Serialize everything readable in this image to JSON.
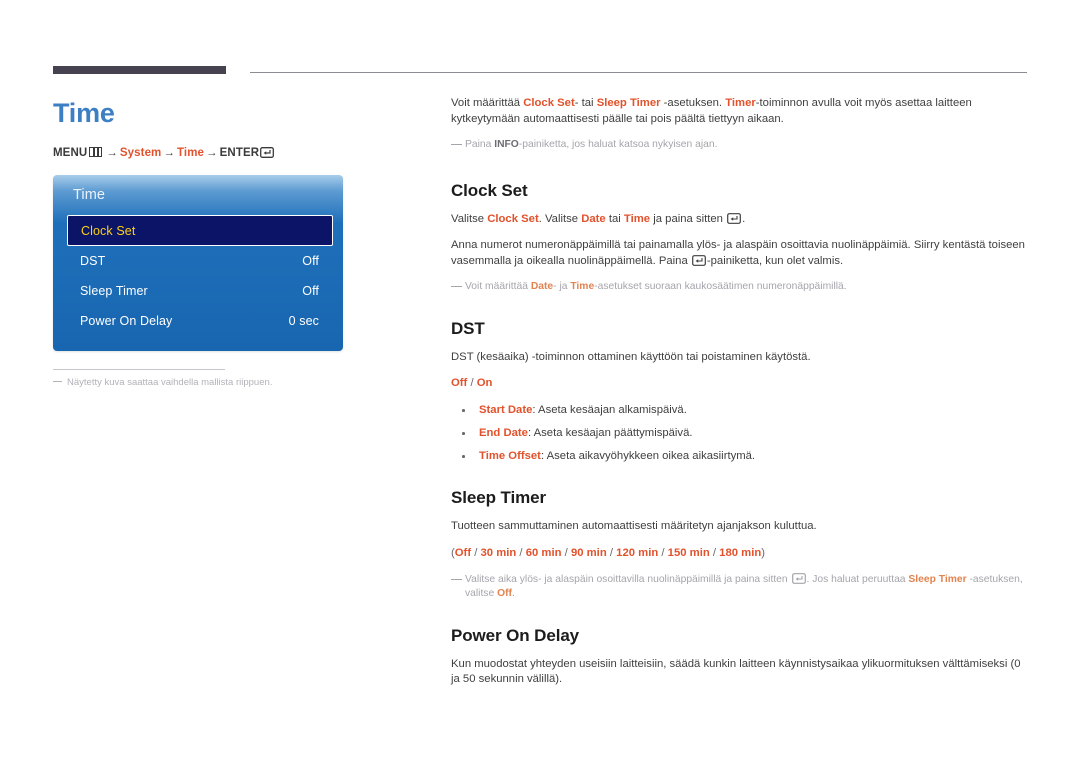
{
  "page": {
    "title": "Time",
    "menu_path": {
      "menu_label": "MENU",
      "menu_icon": "menu-bars-icon",
      "arrow": "→",
      "step1": "System",
      "step2": "Time",
      "enter_label": "ENTER",
      "enter_icon": "enter-key-icon"
    }
  },
  "osd": {
    "title": "Time",
    "rows": [
      {
        "label": "Clock Set",
        "value": "",
        "selected": true
      },
      {
        "label": "DST",
        "value": "Off",
        "selected": false
      },
      {
        "label": "Sleep Timer",
        "value": "Off",
        "selected": false
      },
      {
        "label": "Power On Delay",
        "value": "0 sec",
        "selected": false
      }
    ],
    "footnote": "Näytetty kuva saattaa vaihdella mallista riippuen."
  },
  "intro": {
    "p1_a": "Voit määrittää ",
    "p1_k1": "Clock Set",
    "p1_b": "- tai ",
    "p1_k2": "Sleep Timer",
    "p1_c": " -asetuksen. ",
    "p1_k3": "Timer",
    "p1_d": "-toiminnon avulla voit myös asettaa laitteen kytkeytymään automaattisesti päälle tai pois päältä tiettyyn aikaan.",
    "note_a": "Paina ",
    "note_k": "INFO",
    "note_b": "-painiketta, jos haluat katsoa nykyisen ajan."
  },
  "clock_set": {
    "heading": "Clock Set",
    "p1_a": "Valitse ",
    "p1_k1": "Clock Set",
    "p1_b": ". Valitse ",
    "p1_k2": "Date",
    "p1_c": " tai ",
    "p1_k3": "Time",
    "p1_d": " ja paina sitten ",
    "p1_e": ".",
    "p2_a": "Anna numerot numeronäppäimillä tai painamalla ylös- ja alaspäin osoittavia nuolinäppäimiä. Siirry kentästä toiseen vasemmalla ja oikealla nuolinäppäimellä. Paina ",
    "p2_b": "-painiketta, kun olet valmis.",
    "note_a": "Voit määrittää ",
    "note_k1": "Date",
    "note_b": "- ja ",
    "note_k2": "Time",
    "note_c": "-asetukset suoraan kaukosäätimen numeronäppäimillä."
  },
  "dst": {
    "heading": "DST",
    "p1": "DST (kesäaika) -toiminnon ottaminen käyttöön tai poistaminen käytöstä.",
    "options_off": "Off",
    "options_sep": " / ",
    "options_on": "On",
    "bullets": [
      {
        "key": "Start Date",
        "text": ": Aseta kesäajan alkamispäivä."
      },
      {
        "key": "End Date",
        "text": ": Aseta kesäajan päättymispäivä."
      },
      {
        "key": "Time Offset",
        "text": ": Aseta aikavyöhykkeen oikea aikasiirtymä."
      }
    ]
  },
  "sleep_timer": {
    "heading": "Sleep Timer",
    "p1": "Tuotteen sammuttaminen automaattisesti määritetyn ajanjakson kuluttua.",
    "options_open": "(",
    "options": [
      "Off",
      "30 min",
      "60 min",
      "90 min",
      "120 min",
      "150 min",
      "180 min"
    ],
    "options_sep": " / ",
    "options_close": ")",
    "note_a": "Valitse aika ylös- ja alaspäin osoittavilla nuolinäppäimillä ja paina sitten ",
    "note_b": ". Jos haluat peruuttaa ",
    "note_k1": "Sleep Timer",
    "note_c": " -asetuksen, valitse ",
    "note_k2": "Off",
    "note_d": "."
  },
  "power_on_delay": {
    "heading": "Power On Delay",
    "p1": "Kun muodostat yhteyden useisiin laitteisiin, säädä kunkin laitteen käynnistysaikaa ylikuormituksen välttämiseksi (0 ja 50 sekunnin välillä)."
  },
  "colors": {
    "title_blue": "#3c7fc4",
    "accent_orange": "#e2522c",
    "osd_blue": "#1966b0",
    "osd_selected": "#0b1466",
    "osd_selected_text": "#fcd116",
    "rule_dark": "#46424f"
  }
}
